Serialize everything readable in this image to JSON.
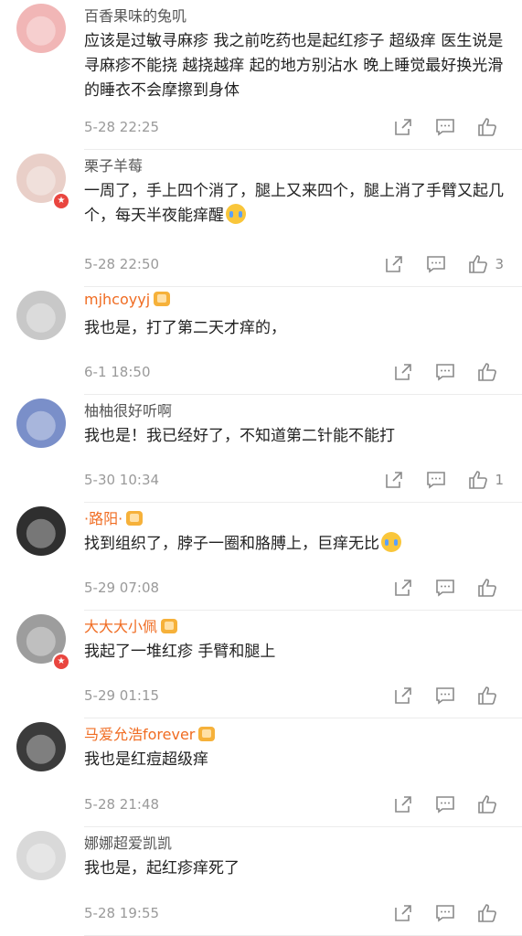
{
  "comments": [
    {
      "user": "百香果味的兔叽",
      "vip": false,
      "verified": false,
      "text": "应该是过敏寻麻疹 我之前吃药也是起红疹子 超级痒 医生说是寻麻疹不能挠 越挠越痒 起的地方别沾水 晚上睡觉最好换光滑的睡衣不会摩擦到身体",
      "emoji": false,
      "time": "5-28 22:25",
      "likes": "",
      "avatar_color": "#f1b6b6"
    },
    {
      "user": "栗子羊莓",
      "vip": false,
      "verified": true,
      "text": "一周了，手上四个消了，腿上又来四个，腿上消了手臂又起几个，每天半夜能痒醒",
      "emoji": true,
      "time": "5-28 22:50",
      "likes": "3",
      "avatar_color": "#e9cfc8"
    },
    {
      "user": "mjhcoyyj",
      "vip": true,
      "verified": false,
      "text": "我也是，打了第二天才痒的，",
      "emoji": false,
      "time": "6-1 18:50",
      "likes": "",
      "avatar_color": "#c8c8c8"
    },
    {
      "user": "柚柚很好听啊",
      "vip": false,
      "verified": false,
      "text": "我也是！我已经好了，不知道第二针能不能打",
      "emoji": false,
      "time": "5-30 10:34",
      "likes": "1",
      "avatar_color": "#7a8fc9"
    },
    {
      "user": "·路阳·",
      "vip": true,
      "verified": false,
      "text": "找到组织了，脖子一圈和胳膊上，巨痒无比",
      "emoji": true,
      "time": "5-29 07:08",
      "likes": "",
      "avatar_color": "#2f2f2f"
    },
    {
      "user": "大大大小佩",
      "vip": true,
      "verified": true,
      "text": "我起了一堆红疹 手臂和腿上",
      "emoji": false,
      "time": "5-29 01:15",
      "likes": "",
      "avatar_color": "#9d9d9d"
    },
    {
      "user": "马爱允浩forever",
      "vip": true,
      "verified": false,
      "text": "我也是红痘超级痒",
      "emoji": false,
      "time": "5-28 21:48",
      "likes": "",
      "avatar_color": "#3b3b3b"
    },
    {
      "user": "娜娜超爱凯凯",
      "vip": false,
      "verified": false,
      "text": "我也是，起红疹痒死了",
      "emoji": false,
      "time": "5-28 19:55",
      "likes": "",
      "avatar_color": "#d9d9d9"
    }
  ],
  "icons": {
    "share": "share-icon",
    "reply": "comment-icon",
    "like": "thumbs-up-icon"
  }
}
